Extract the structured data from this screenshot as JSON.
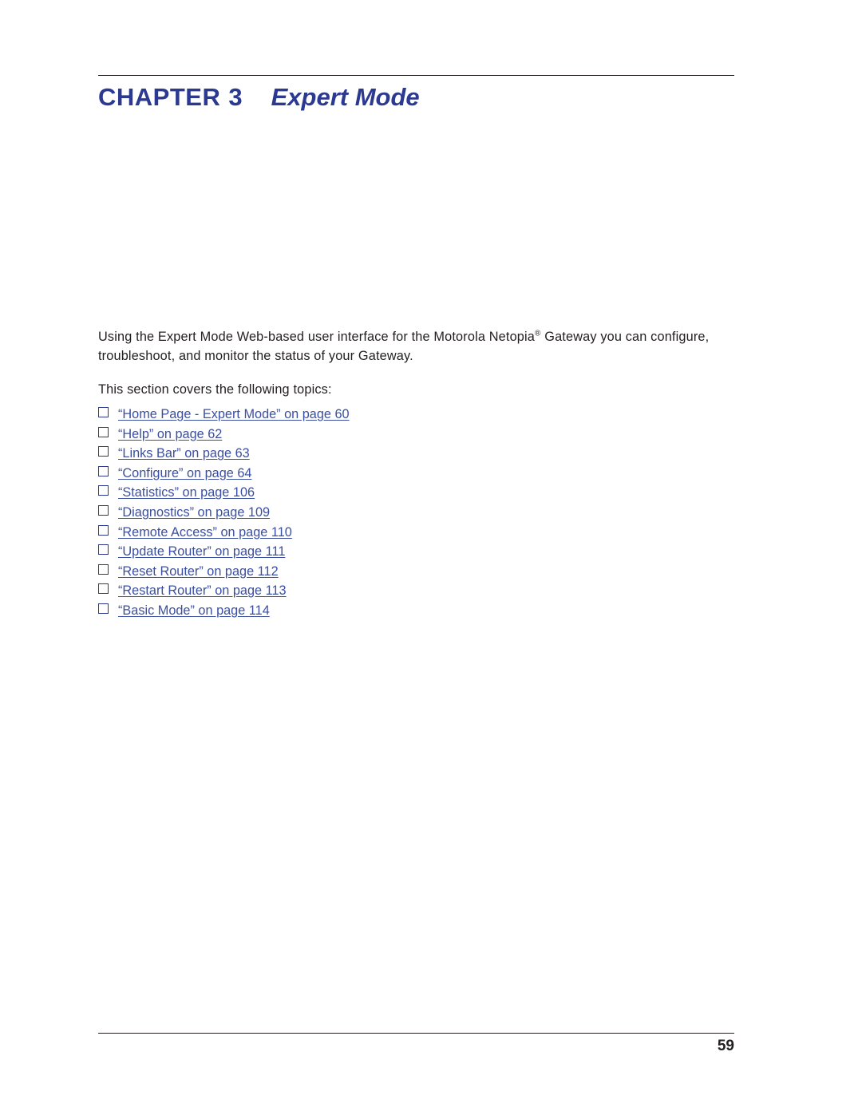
{
  "document": {
    "chapter_word": "CHAPTER",
    "chapter_number": "3",
    "chapter_title": "Expert Mode",
    "intro_paragraph_part1": "Using the Expert Mode Web-based user interface for the Motorola Netopia",
    "intro_registered_mark": "®",
    "intro_paragraph_part2": " Gateway you can configure, troubleshoot, and monitor the status of your Gateway.",
    "topics_lead_in": "This section covers the following topics:",
    "page_number": "59",
    "topics": [
      {
        "label": "“Home Page - Expert Mode” on page 60"
      },
      {
        "label": "“Help” on page 62"
      },
      {
        "label": "“Links Bar” on page 63"
      },
      {
        "label": "“Configure” on page 64"
      },
      {
        "label": "“Statistics” on page 106"
      },
      {
        "label": "“Diagnostics” on page 109"
      },
      {
        "label": "“Remote Access” on page 110"
      },
      {
        "label": "“Update Router” on page 111"
      },
      {
        "label": "“Reset Router” on page 112"
      },
      {
        "label": "“Restart Router” on page 113"
      },
      {
        "label": "“Basic Mode” on page 114"
      }
    ],
    "colors": {
      "heading_blue": "#2b3990",
      "link_blue": "#3b4fa0",
      "text_black": "#231f20"
    }
  }
}
